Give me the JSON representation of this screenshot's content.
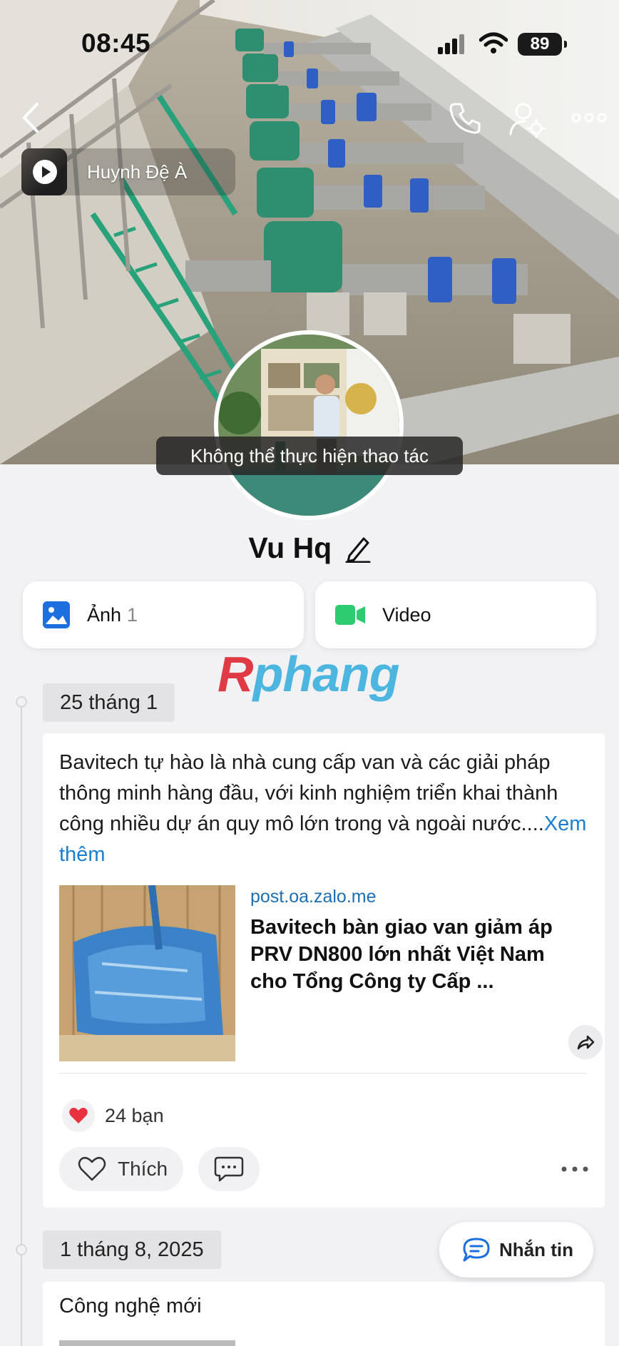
{
  "status_bar": {
    "time": "08:45",
    "battery": "89"
  },
  "header": {
    "back_icon": "chevron-left-icon",
    "call_icon": "phone-icon",
    "settings_icon": "user-gear-icon",
    "more_icon": "ellipsis-icon"
  },
  "story": {
    "name": "Huynh Đệ À"
  },
  "toast": {
    "message": "Không thể thực hiện thao tác"
  },
  "profile": {
    "name": "Vu Hq"
  },
  "media_tabs": [
    {
      "label": "Ảnh",
      "count": "1",
      "icon": "image-icon",
      "color": "#1d6fe0"
    },
    {
      "label": "Video",
      "icon": "video-camera-icon",
      "color": "#2ecc71"
    }
  ],
  "watermark": {
    "r": "R",
    "rest": "phang"
  },
  "timeline": [
    {
      "date": "25 tháng 1",
      "text": "Bavitech tự hào là nhà cung cấp van và các giải pháp thông minh hàng đầu, với kinh nghiệm triển khai thành công nhiều dự án quy mô lớn trong và ngoài nước....",
      "see_more": "Xem thêm",
      "link": {
        "domain": "post.oa.zalo.me",
        "title": "Bavitech bàn giao van giảm áp PRV DN800 lớn nhất Việt Nam cho Tổng Công ty Cấp ..."
      },
      "reactions": "24 bạn",
      "like_label": "Thích"
    },
    {
      "date": "1 tháng 8, 2025",
      "text": "Công nghệ mới"
    }
  ],
  "message_button": {
    "label": "Nhắn tin"
  },
  "colors": {
    "accent": "#1a7fd1",
    "like_heart": "#e8323f"
  }
}
